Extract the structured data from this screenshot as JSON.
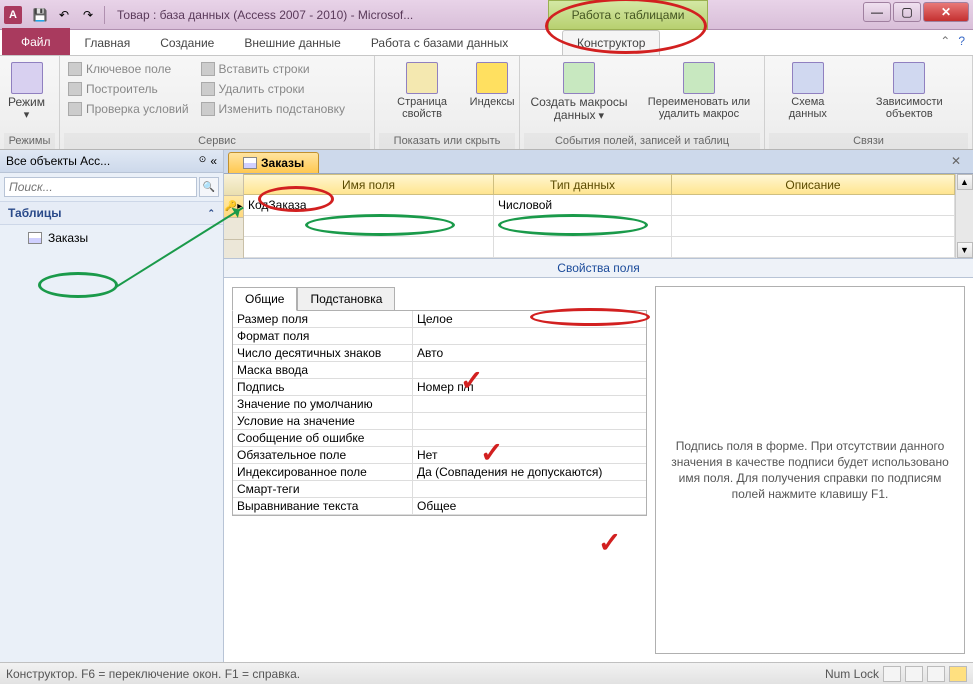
{
  "titlebar": {
    "app_letter": "A",
    "title": "Товар : база данных (Access 2007 - 2010) - Microsof...",
    "contextual": "Работа с таблицами"
  },
  "tabs": {
    "file": "Файл",
    "items": [
      "Главная",
      "Создание",
      "Внешние данные",
      "Работа с базами данных"
    ],
    "contextual": "Конструктор"
  },
  "ribbon": {
    "groups": {
      "modes": {
        "label": "Режимы",
        "mode_btn": "Режим"
      },
      "service": {
        "label": "Сервис",
        "buttons": [
          "Ключевое поле",
          "Построитель",
          "Проверка условий",
          "Вставить строки",
          "Удалить строки",
          "Изменить подстановку"
        ]
      },
      "show_hide": {
        "label": "Показать или скрыть",
        "buttons": [
          "Страница свойств",
          "Индексы"
        ]
      },
      "events": {
        "label": "События полей, записей и таблиц",
        "buttons": [
          "Создать макросы данных",
          "Переименовать или удалить макрос"
        ]
      },
      "relations": {
        "label": "Связи",
        "buttons": [
          "Схема данных",
          "Зависимости объектов"
        ]
      }
    }
  },
  "nav": {
    "header": "Все объекты Acc...",
    "search_placeholder": "Поиск...",
    "group": "Таблицы",
    "item": "Заказы"
  },
  "doc": {
    "tab": "Заказы",
    "columns": {
      "name": "Имя поля",
      "type": "Тип данных",
      "desc": "Описание"
    },
    "rows": [
      {
        "name": "КодЗаказа",
        "type": "Числовой",
        "desc": ""
      }
    ]
  },
  "props": {
    "header": "Свойства поля",
    "tabs": {
      "general": "Общие",
      "lookup": "Подстановка"
    },
    "rows": [
      {
        "name": "Размер поля",
        "value": "Целое"
      },
      {
        "name": "Формат поля",
        "value": ""
      },
      {
        "name": "Число десятичных знаков",
        "value": "Авто"
      },
      {
        "name": "Маска ввода",
        "value": ""
      },
      {
        "name": "Подпись",
        "value": "Номер п/п"
      },
      {
        "name": "Значение по умолчанию",
        "value": ""
      },
      {
        "name": "Условие на значение",
        "value": ""
      },
      {
        "name": "Сообщение об ошибке",
        "value": ""
      },
      {
        "name": "Обязательное поле",
        "value": "Нет"
      },
      {
        "name": "Индексированное поле",
        "value": "Да (Совпадения не допускаются)"
      },
      {
        "name": "Смарт-теги",
        "value": ""
      },
      {
        "name": "Выравнивание текста",
        "value": "Общее"
      }
    ],
    "help": "Подпись поля в форме. При отсутствии данного значения в качестве подписи будет использовано имя поля. Для получения справки по подписям полей нажмите клавишу F1."
  },
  "status": {
    "text": "Конструктор.  F6 = переключение окон.  F1 = справка.",
    "numlock": "Num Lock"
  }
}
